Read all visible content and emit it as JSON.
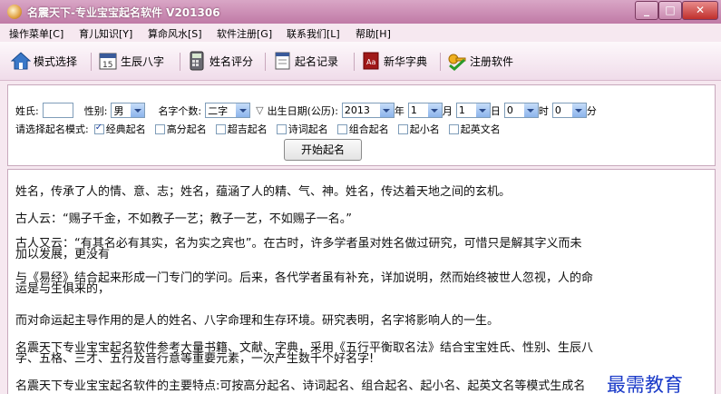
{
  "window": {
    "title": "名震天下-专业宝宝起名软件 V201306",
    "minimize": "_",
    "maximize": "□",
    "close": "✕"
  },
  "menu": [
    "操作菜单[C]",
    "育儿知识[Y]",
    "算命风水[S]",
    "软件注册[G]",
    "联系我们[L]",
    "帮助[H]"
  ],
  "toolbar": [
    {
      "label": "模式选择",
      "icon": "home-icon"
    },
    {
      "label": "生辰八字",
      "icon": "calendar-icon"
    },
    {
      "label": "姓名评分",
      "icon": "calculator-icon"
    },
    {
      "label": "起名记录",
      "icon": "notebook-icon"
    },
    {
      "label": "新华字典",
      "icon": "dictionary-icon"
    },
    {
      "label": "注册软件",
      "icon": "register-icon"
    }
  ],
  "form": {
    "surname_label": "姓氏:",
    "surname_value": "",
    "gender_label": "性别:",
    "gender_value": "男",
    "name_count_label": "名字个数:",
    "name_count_value": "二字",
    "birth_label": "出生日期(公历):",
    "year_value": "2013",
    "year_unit": "年",
    "month_value": "1",
    "month_unit": "月",
    "day_value": "1",
    "day_unit": "日",
    "hour_value": "0",
    "hour_unit": "时",
    "minute_value": "0",
    "minute_unit": "分",
    "mode_label": "请选择起名模式:",
    "modes": [
      {
        "label": "经典起名",
        "checked": true
      },
      {
        "label": "高分起名",
        "checked": false
      },
      {
        "label": "超吉起名",
        "checked": false
      },
      {
        "label": "诗词起名",
        "checked": false
      },
      {
        "label": "组合起名",
        "checked": false
      },
      {
        "label": "起小名",
        "checked": false
      },
      {
        "label": "起英文名",
        "checked": false
      }
    ],
    "start_button": "开始起名"
  },
  "content": {
    "p1": "姓名，传承了人的情、意、志；姓名，蕴涵了人的精、气、神。姓名，传达着天地之间的玄机。",
    "p2": "古人云：“赐子千金，不如教子一艺；教子一艺，不如赐子一名。”",
    "p3a": "古人又云：“有其名必有其实，名为实之宾也”。在古时，许多学者虽对姓名做过研究，可惜只是解其字义而未",
    "p3b": "加以发展，更没有",
    "p4a": "与《易经》结合起来形成一门专门的学问。后来，各代学者虽有补充，详加说明，然而始终被世人忽视，人的命",
    "p4b": "运是与生俱来的，",
    "p5": "而对命运起主导作用的是人的姓名、八字命理和生存环境。研究表明，名字将影响人的一生。",
    "p6a": "名震天下专业宝宝起名软件参考大量书籍、文献、字典，采用《五行平衡取名法》结合宝宝姓氏、性别、生辰八",
    "p6b": "字、五格、三才、五行及音行意等重要元素，一次产生数千个好名字!",
    "p7": "名震天下专业宝宝起名软件的主要特点:可按高分起名、诗词起名、组合起名、起小名、起英文名等模式生成名"
  },
  "watermark": "最需教育"
}
